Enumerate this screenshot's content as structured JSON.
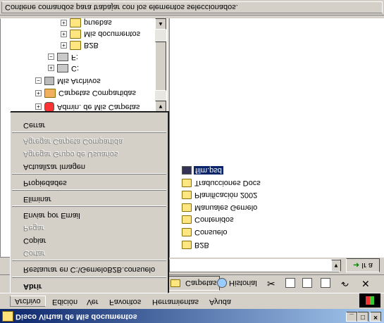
{
  "window": {
    "title": "Disco Virtual de Mis documentos"
  },
  "menubar": [
    "Archivo",
    "Edición",
    "Ver",
    "Favoritos",
    "Herramientas",
    "Ayuda"
  ],
  "toolbar": {
    "folders": "Carpetas",
    "history": "Historial"
  },
  "address": {
    "go": "Ir a"
  },
  "archivo_menu": [
    {
      "label": "Abrir",
      "enabled": true,
      "default": true
    },
    {
      "label": "Restaurar en C:\\GemeloB2B.consuelo",
      "enabled": true
    },
    {
      "label": "Cortar",
      "enabled": false
    },
    {
      "label": "Copiar",
      "enabled": true
    },
    {
      "label": "Pegar",
      "enabled": false
    },
    {
      "label": "Enviar por Email",
      "enabled": true
    },
    {
      "label": "Eliminar",
      "enabled": true
    },
    {
      "label": "Propiedades",
      "enabled": true
    },
    {
      "label": "Actualizar Imagen",
      "enabled": true
    },
    {
      "label": "Agregar Grupo de Usuarios",
      "enabled": false
    },
    {
      "label": "Agregar Carpeta Compartida",
      "enabled": false
    },
    {
      "label": "Cerrar",
      "enabled": true
    }
  ],
  "tree": {
    "admin": "Admin. de Mis Carpetas",
    "shared": "Carpetas Compartidas",
    "myfiles": "Mis Archivos",
    "c": "C:",
    "f": "F:",
    "b2b": "B2B",
    "mydocs": "Mis documentos",
    "pruebas": "pruebas"
  },
  "files": [
    "B2B",
    "Consuelo",
    "Contenidos",
    "Manuales Gemelo",
    "Planificación 2002",
    "Traducciones Docs",
    "film.psd"
  ],
  "status": "Contiene comandos para trabajar con los elementos seleccionados."
}
